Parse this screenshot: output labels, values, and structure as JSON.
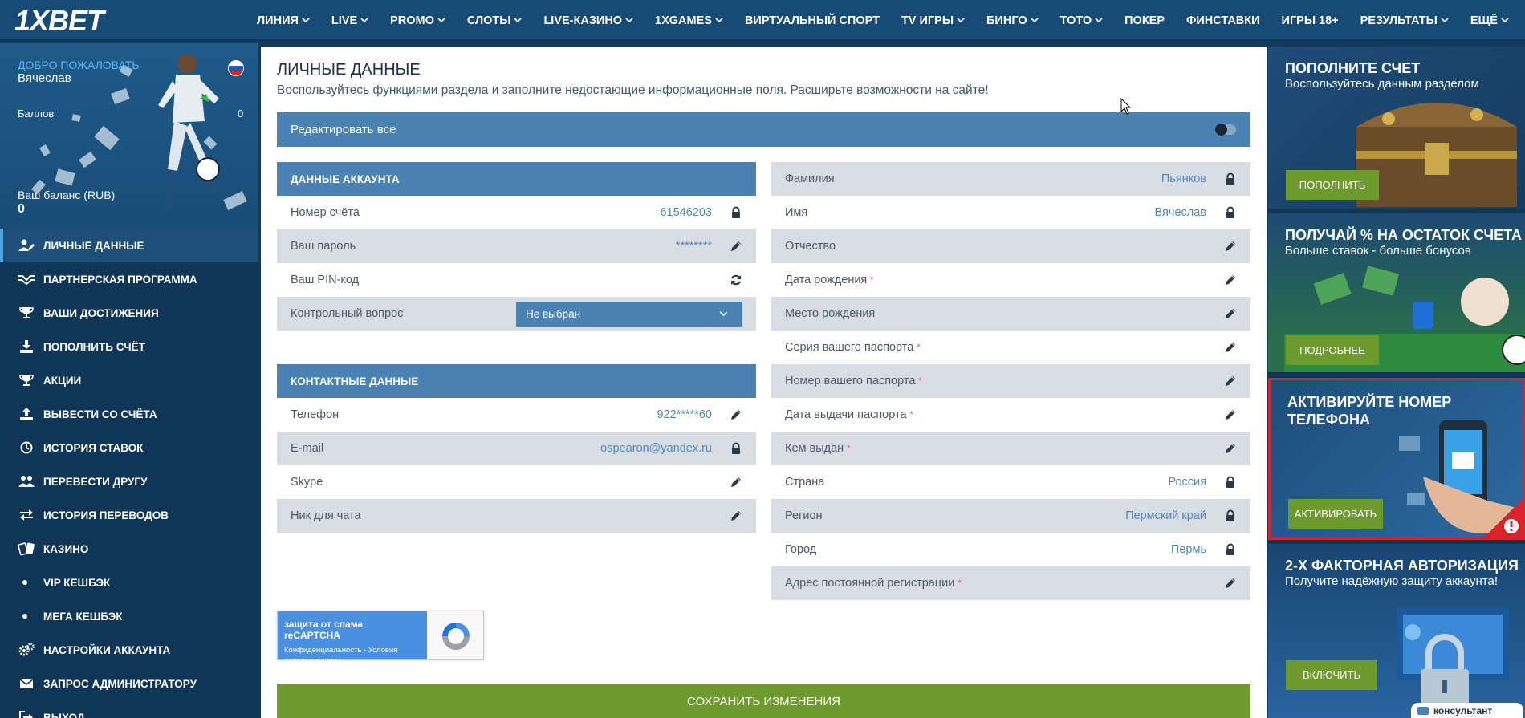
{
  "brand": {
    "logo": "1XBET"
  },
  "nav": [
    {
      "label": "ЛИНИЯ",
      "dropdown": true
    },
    {
      "label": "LIVE",
      "dropdown": true
    },
    {
      "label": "PROMO",
      "dropdown": true
    },
    {
      "label": "СЛОТЫ",
      "dropdown": true
    },
    {
      "label": "LIVE-КАЗИНО",
      "dropdown": true
    },
    {
      "label": "1XGAMES",
      "dropdown": true
    },
    {
      "label": "ВИРТУАЛЬНЫЙ СПОРТ",
      "dropdown": false
    },
    {
      "label": "TV ИГРЫ",
      "dropdown": true
    },
    {
      "label": "БИНГО",
      "dropdown": true
    },
    {
      "label": "ТОТО",
      "dropdown": true
    },
    {
      "label": "ПОКЕР",
      "dropdown": false
    },
    {
      "label": "ФИНСТАВКИ",
      "dropdown": false
    },
    {
      "label": "ИГРЫ 18+",
      "dropdown": false
    },
    {
      "label": "РЕЗУЛЬТАТЫ",
      "dropdown": true
    },
    {
      "label": "ЕЩЁ",
      "dropdown": true
    }
  ],
  "profile": {
    "welcome": "ДОБРО ПОЖАЛОВАТЬ",
    "name": "Вячеслав",
    "points_label": "Баллов",
    "points_value": "0",
    "balance_label": "Ваш баланс (RUB)",
    "balance_value": "0"
  },
  "menu": [
    {
      "label": "ЛИЧНЫЕ ДАННЫЕ",
      "icon": "user-edit-icon",
      "active": true
    },
    {
      "label": "ПАРТНЕРСКАЯ ПРОГРАММА",
      "icon": "handshake-icon"
    },
    {
      "label": "ВАШИ ДОСТИЖЕНИЯ",
      "icon": "trophy-icon"
    },
    {
      "label": "ПОПОЛНИТЬ СЧЁТ",
      "icon": "download-icon"
    },
    {
      "label": "АКЦИИ",
      "icon": "trophy-icon"
    },
    {
      "label": "ВЫВЕСТИ СО СЧЁТА",
      "icon": "upload-icon"
    },
    {
      "label": "ИСТОРИЯ СТАВОК",
      "icon": "clock-icon"
    },
    {
      "label": "ПЕРЕВЕСТИ ДРУГУ",
      "icon": "users-icon"
    },
    {
      "label": "ИСТОРИЯ ПЕРЕВОДОВ",
      "icon": "exchange-icon"
    },
    {
      "label": "КАЗИНО",
      "icon": "cards-icon"
    },
    {
      "label": "VIP КЕШБЭК",
      "icon": "bullet",
      "sub": true
    },
    {
      "label": "МЕГА КЕШБЭК",
      "icon": "bullet",
      "sub": true
    },
    {
      "label": "НАСТРОЙКИ АККАУНТА",
      "icon": "gears-icon"
    },
    {
      "label": "ЗАПРОС АДМИНИСТРАТОРУ",
      "icon": "envelope-icon"
    },
    {
      "label": "ВЫХОД",
      "icon": "logout-icon"
    }
  ],
  "page": {
    "title": "ЛИЧНЫЕ ДАННЫЕ",
    "subtitle": "Воспользуйтесь функциями раздела и заполните недостающие информационные поля. Расширьте возможности на сайте!",
    "edit_all": "Редактировать все",
    "account_header": "ДАННЫЕ АККАУНТА",
    "account_rows": [
      {
        "label": "Номер счёта",
        "value": "61546203",
        "icon": "lock-icon"
      },
      {
        "label": "Ваш пароль",
        "value": "********",
        "icon": "pencil-icon"
      },
      {
        "label": "Ваш PIN-код",
        "value": "",
        "icon": "refresh-icon"
      },
      {
        "label": "Контрольный вопрос",
        "select": "Не выбран"
      }
    ],
    "contact_header": "КОНТАКТНЫЕ ДАННЫЕ",
    "contact_rows": [
      {
        "label": "Телефон",
        "value": "922*****60",
        "icon": "pencil-icon"
      },
      {
        "label": "E-mail",
        "value": "ospearon@yandex.ru",
        "icon": "lock-icon"
      },
      {
        "label": "Skype",
        "value": "",
        "icon": "pencil-icon"
      },
      {
        "label": "Ник для чата",
        "value": "",
        "icon": "pencil-icon"
      }
    ],
    "personal_rows": [
      {
        "label": "Фамилия",
        "value": "Пьянков",
        "icon": "lock-icon",
        "required": false
      },
      {
        "label": "Имя",
        "value": "Вячеслав",
        "icon": "lock-icon",
        "required": false
      },
      {
        "label": "Отчество",
        "value": "",
        "icon": "pencil-icon",
        "required": false
      },
      {
        "label": "Дата рождения",
        "value": "",
        "icon": "pencil-icon",
        "required": true
      },
      {
        "label": "Место рождения",
        "value": "",
        "icon": "pencil-icon",
        "required": false
      },
      {
        "label": "Серия вашего паспорта",
        "value": "",
        "icon": "pencil-icon",
        "required": true
      },
      {
        "label": "Номер вашего паспорта",
        "value": "",
        "icon": "pencil-icon",
        "required": true
      },
      {
        "label": "Дата выдачи паспорта",
        "value": "",
        "icon": "pencil-icon",
        "required": true
      },
      {
        "label": "Кем выдан",
        "value": "",
        "icon": "pencil-icon",
        "required": true
      },
      {
        "label": "Страна",
        "value": "Россия",
        "icon": "lock-icon",
        "required": false
      },
      {
        "label": "Регион",
        "value": "Пермский край",
        "icon": "lock-icon",
        "required": false
      },
      {
        "label": "Город",
        "value": "Пермь",
        "icon": "lock-icon",
        "required": false
      },
      {
        "label": "Адрес постоянной регистрации",
        "value": "",
        "icon": "pencil-icon",
        "required": true
      }
    ],
    "required_mark": "*",
    "recaptcha": {
      "title": "защита от спама reCAPTCHA",
      "sub": "Конфиденциальность - Условия использования"
    },
    "save": "СОХРАНИТЬ ИЗМЕНЕНИЯ"
  },
  "banners": [
    {
      "title": "ПОПОЛНИТЕ СЧЕТ",
      "sub": "Воспользуйтесь данным разделом",
      "button": "ПОПОЛНИТЬ"
    },
    {
      "title": "ПОЛУЧАЙ % НА ОСТАТОК СЧЕТА",
      "sub": "Больше ставок - больше бонусов",
      "button": "ПОДРОБНЕЕ"
    },
    {
      "title": "АКТИВИРУЙТЕ НОМЕР ТЕЛЕФОНА",
      "sub": "",
      "button": "АКТИВИРОВАТЬ"
    },
    {
      "title": "2-Х ФАКТОРНАЯ АВТОРИЗАЦИЯ",
      "sub": "Получите надёжную защиту аккаунта!",
      "button": "ВКЛЮЧИТЬ"
    }
  ],
  "consultant": "консультант",
  "colors": {
    "nav": "#174a74",
    "sidebar": "#0f3657",
    "accent": "#4a83b3",
    "row_shade": "#d7dde3",
    "value": "#4f89bc",
    "green": "#6c9a2c",
    "required": "#e25757"
  }
}
